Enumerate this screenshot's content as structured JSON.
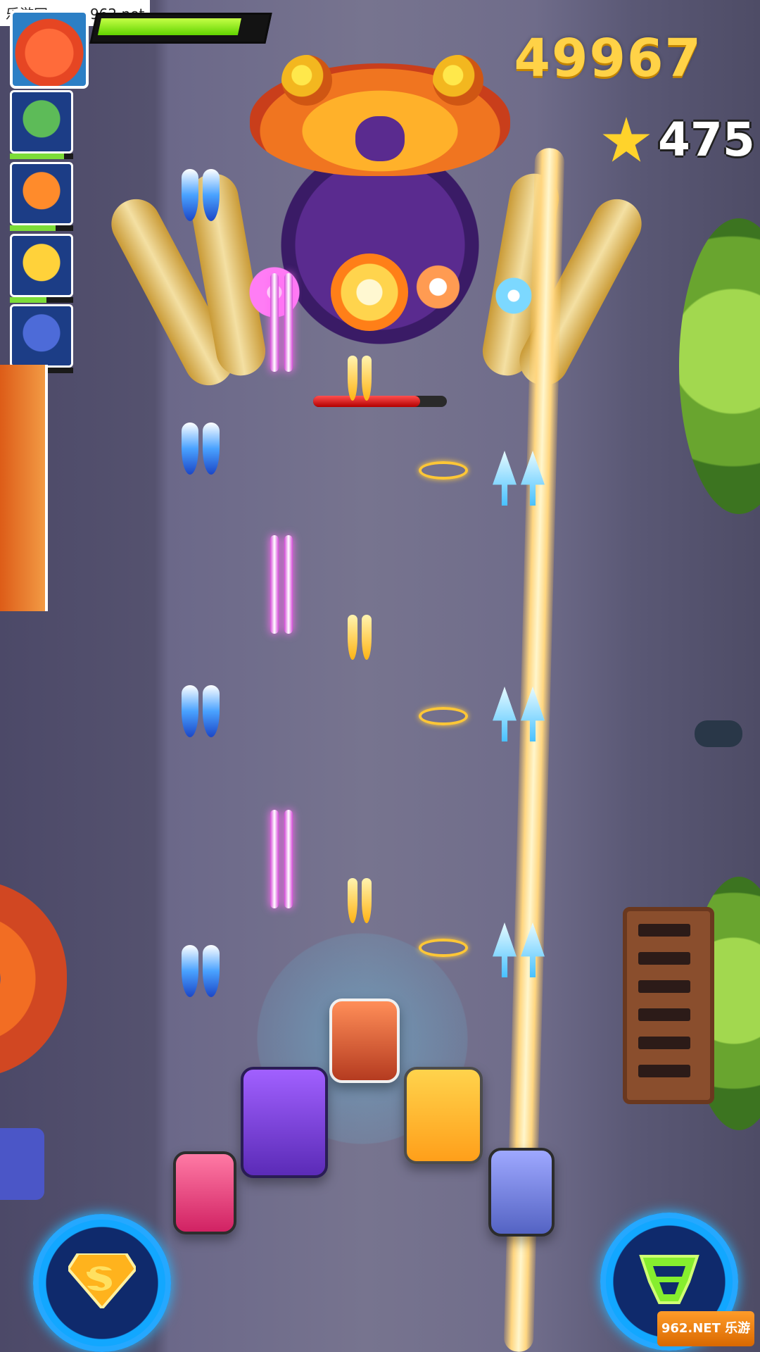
{
  "watermark": "乐游网 www.962.net",
  "score": "49967",
  "coins": "475",
  "player_hp_fraction": 0.88,
  "boss_hp_fraction": 0.8,
  "wingmen": [
    {
      "name": "wingman-1",
      "hp": 0.85,
      "color": "#5dbb58"
    },
    {
      "name": "wingman-2",
      "hp": 0.72,
      "color": "#ff8b2b"
    },
    {
      "name": "wingman-3",
      "hp": 0.58,
      "color": "#ffd23a"
    },
    {
      "name": "wingman-4",
      "hp": 0.18,
      "color": "#4d6bd8"
    }
  ],
  "corner_logo": "962.NET 乐游网",
  "icons": {
    "hero": "hero-portrait-icon",
    "coin": "star-icon",
    "skill1": "super-skill-icon",
    "skill2": "transform-skill-icon"
  },
  "colors": {
    "score": "#ffd247",
    "coins": "#ffffff",
    "player_hp": "#7ddc1f",
    "boss_hp": "#d20b0b",
    "skill_ring": "#25a8ff"
  }
}
